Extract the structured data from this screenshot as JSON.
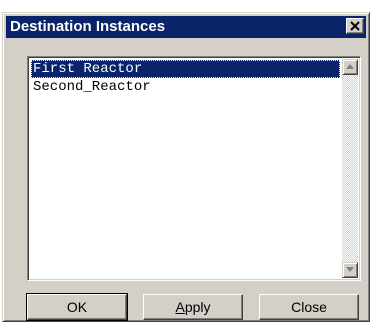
{
  "window": {
    "title": "Destination Instances",
    "close_icon": "close-x-icon"
  },
  "listbox": {
    "items": [
      {
        "label": "First Reactor",
        "selected": true
      },
      {
        "label": "Second_Reactor",
        "selected": false
      }
    ],
    "scroll_up_icon": "arrow-up-icon",
    "scroll_down_icon": "arrow-down-icon"
  },
  "buttons": {
    "ok_label": "OK",
    "apply_mnemonic": "A",
    "apply_rest": "pply",
    "close_label": "Close"
  }
}
